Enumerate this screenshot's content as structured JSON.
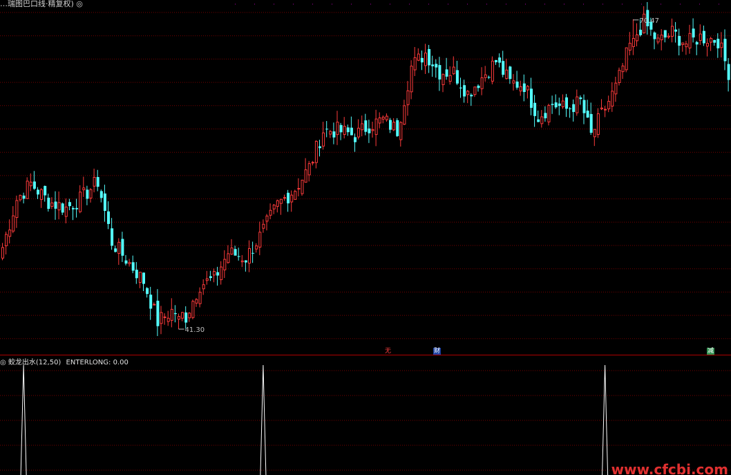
{
  "main": {
    "title": "…瑞图巴口线·精复权) ◎",
    "max_label": "70.47",
    "min_label": "41.30"
  },
  "markers": {
    "a": "无",
    "b": "财",
    "c": "减"
  },
  "indicator": {
    "name": "◎ 蛟龙出水(12,50)",
    "line_label": "ENTERLONG: 0.00"
  },
  "watermark": "www.cfcbi.com",
  "colors": {
    "up": "#ff3b3b",
    "down": "#54ffff",
    "grid": "#7a0000",
    "signal": "#ffffff"
  },
  "chart_data": {
    "type": "candlestick",
    "price_range": [
      40.0,
      71.5
    ],
    "max_price": 70.47,
    "min_price": 41.3,
    "close_path": [
      {
        "bar": 0,
        "close": 49.0
      },
      {
        "bar": 4,
        "close": 53.5
      },
      {
        "bar": 8,
        "close": 55.0
      },
      {
        "bar": 13,
        "close": 53.3
      },
      {
        "bar": 18,
        "close": 52.7
      },
      {
        "bar": 22,
        "close": 53.5
      },
      {
        "bar": 27,
        "close": 55.2
      },
      {
        "bar": 31,
        "close": 49.5
      },
      {
        "bar": 36,
        "close": 47.5
      },
      {
        "bar": 40,
        "close": 45.8
      },
      {
        "bar": 44,
        "close": 42.0
      },
      {
        "bar": 48,
        "close": 43.0
      },
      {
        "bar": 52,
        "close": 42.5
      },
      {
        "bar": 56,
        "close": 45.5
      },
      {
        "bar": 60,
        "close": 46.0
      },
      {
        "bar": 64,
        "close": 48.5
      },
      {
        "bar": 69,
        "close": 48.0
      },
      {
        "bar": 73,
        "close": 50.0
      },
      {
        "bar": 78,
        "close": 53.0
      },
      {
        "bar": 83,
        "close": 54.5
      },
      {
        "bar": 87,
        "close": 56.5
      },
      {
        "bar": 91,
        "close": 60.0
      },
      {
        "bar": 95,
        "close": 60.0
      },
      {
        "bar": 100,
        "close": 59.5
      },
      {
        "bar": 104,
        "close": 60.5
      },
      {
        "bar": 108,
        "close": 61.0
      },
      {
        "bar": 112,
        "close": 60.0
      },
      {
        "bar": 116,
        "close": 66.0
      },
      {
        "bar": 120,
        "close": 67.3
      },
      {
        "bar": 124,
        "close": 65.5
      },
      {
        "bar": 128,
        "close": 65.5
      },
      {
        "bar": 132,
        "close": 63.5
      },
      {
        "bar": 136,
        "close": 65.0
      },
      {
        "bar": 140,
        "close": 66.5
      },
      {
        "bar": 144,
        "close": 64.5
      },
      {
        "bar": 148,
        "close": 64.3
      },
      {
        "bar": 152,
        "close": 61.3
      },
      {
        "bar": 156,
        "close": 62.5
      },
      {
        "bar": 160,
        "close": 62.0
      },
      {
        "bar": 164,
        "close": 62.7
      },
      {
        "bar": 167,
        "close": 59.5
      },
      {
        "bar": 170,
        "close": 61.5
      },
      {
        "bar": 174,
        "close": 64.0
      },
      {
        "bar": 178,
        "close": 68.0
      },
      {
        "bar": 182,
        "close": 70.2
      },
      {
        "bar": 186,
        "close": 68.3
      },
      {
        "bar": 190,
        "close": 69.2
      },
      {
        "bar": 194,
        "close": 68.2
      },
      {
        "bar": 198,
        "close": 68.8
      },
      {
        "bar": 203,
        "close": 68.5
      },
      {
        "bar": 206,
        "close": 65.5
      }
    ],
    "bar_count": 207,
    "max_bar": 179,
    "min_bar": 50,
    "indicator_signal_bars": [
      6,
      74,
      171
    ],
    "indicator_value": 0.0
  }
}
